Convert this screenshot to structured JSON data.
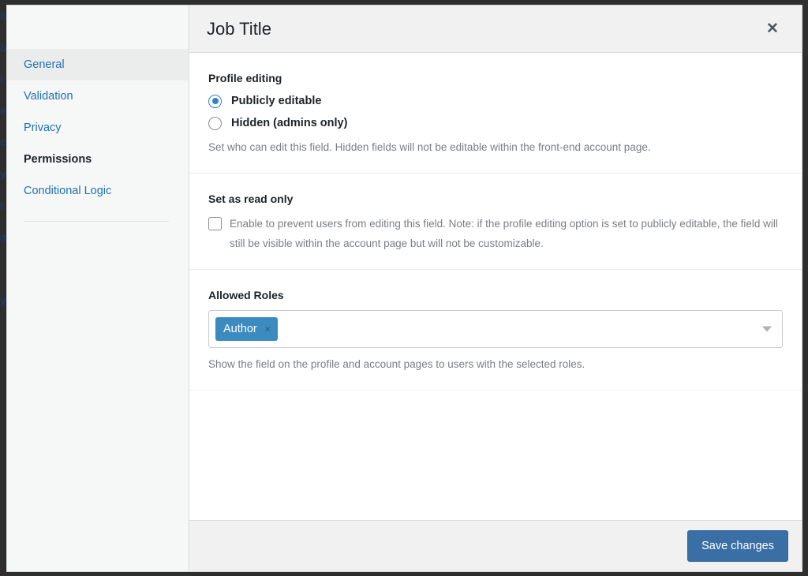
{
  "modal": {
    "title": "Job Title",
    "close_icon": "close-icon"
  },
  "sidebar": {
    "items": [
      {
        "label": "General",
        "state": "hover"
      },
      {
        "label": "Validation",
        "state": "default"
      },
      {
        "label": "Privacy",
        "state": "default"
      },
      {
        "label": "Permissions",
        "state": "active"
      },
      {
        "label": "Conditional Logic",
        "state": "default"
      }
    ]
  },
  "sections": {
    "profile_editing": {
      "title": "Profile editing",
      "options": [
        {
          "label": "Publicly editable",
          "selected": true
        },
        {
          "label": "Hidden (admins only)",
          "selected": false
        }
      ],
      "help": "Set who can edit this field. Hidden fields will not be editable within the front-end account page."
    },
    "read_only": {
      "title": "Set as read only",
      "checkbox_checked": false,
      "checkbox_label": "Enable to prevent users from editing this field. Note: if the profile editing option is set to publicly editable, the field will still be visible within the account page but will not be customizable."
    },
    "allowed_roles": {
      "title": "Allowed Roles",
      "tags": [
        {
          "label": "Author",
          "remove_icon": "×"
        }
      ],
      "caret_icon": "chevron-down-icon",
      "help": "Show the field on the profile and account pages to users with the selected roles."
    }
  },
  "footer": {
    "save_label": "Save changes"
  },
  "colors": {
    "link": "#2271b1",
    "radio_accent": "#3582c4",
    "tag_background": "#3b8bc0",
    "primary_button": "#3a6fa5",
    "header_background": "#f1f1f1",
    "sidebar_background": "#f6f7f7",
    "backdrop": "#2e2e2e"
  },
  "background_fragments": [
    "b",
    "b",
    "i",
    "e",
    "c",
    "y",
    "t",
    "a",
    "",
    "y"
  ]
}
